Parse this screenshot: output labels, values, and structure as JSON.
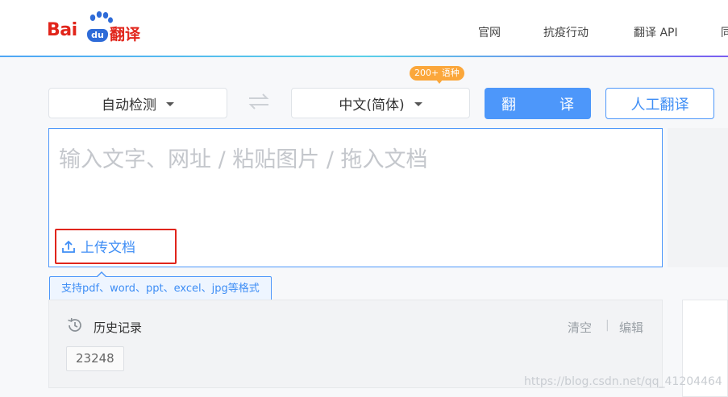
{
  "logo": {
    "bai": "Bai",
    "du": "du",
    "suffix": "翻译"
  },
  "nav": [
    "官网",
    "抗疫行动",
    "翻译 API",
    "同"
  ],
  "source_lang": "自动检测",
  "target_lang": "中文(简体)",
  "badge": "200+ 语种",
  "translate_button": "翻　译",
  "human_button": "人工翻译",
  "input": {
    "placeholder": "输入文字、网址 / 粘贴图片 / 拖入文档"
  },
  "upload": {
    "label": "上传文档"
  },
  "tip": "支持pdf、word、ppt、excel、jpg等格式",
  "history": {
    "title": "历史记录",
    "clear": "清空",
    "separator": "|",
    "edit": "编辑",
    "items": [
      "23248"
    ]
  },
  "watermark": "https://blog.csdn.net/qq_41204464",
  "colors": {
    "accent": "#4d97fa",
    "brand_red": "#e1251b",
    "badge": "#fba73b"
  },
  "icons": [
    "paw-icon",
    "swap-arrows-icon",
    "chevron-down-icon",
    "upload-icon",
    "history-clock-icon"
  ]
}
